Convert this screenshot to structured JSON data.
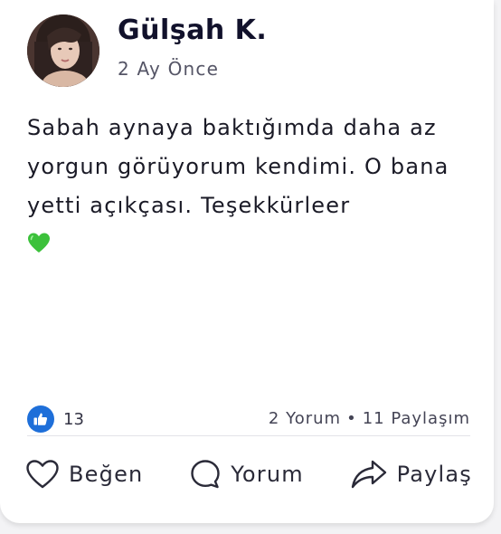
{
  "post": {
    "author": "Gülşah K.",
    "time": "2 Ay Önce",
    "text": "Sabah aynaya baktığımda daha az yorgun görüyorum kendimi. O bana yetti açıkçası. Teşekkürleer",
    "emoji": "green-heart-icon"
  },
  "reactions": {
    "like_count": "13",
    "comments": "2 Yorum",
    "separator": "•",
    "shares": "11 Paylaşım"
  },
  "actions": {
    "like_label": "Beğen",
    "comment_label": "Yorum",
    "share_label": "Paylaş"
  },
  "colors": {
    "like_blue": "#1e6fd9",
    "heart_green": "#3cc13b",
    "name": "#11112b"
  }
}
